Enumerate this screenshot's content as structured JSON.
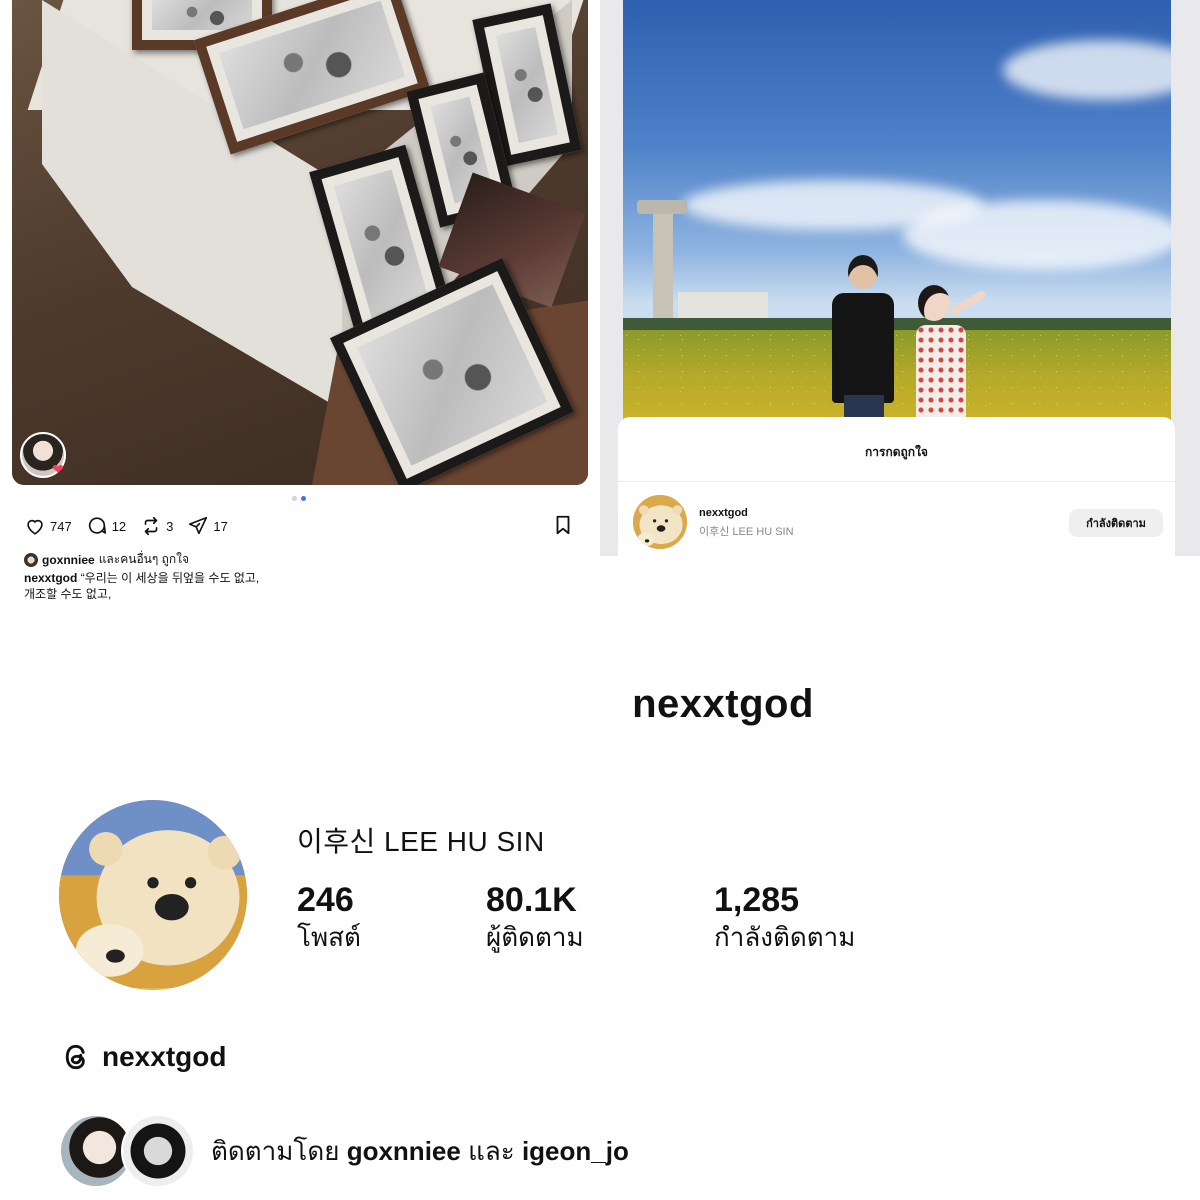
{
  "post": {
    "likes": "747",
    "comments": "12",
    "reposts": "3",
    "shares": "17",
    "liked_by_user": "goxnniee",
    "liked_by_suffix": " และคนอื่นๆ ถูกใจ",
    "caption_user": "nexxtgod",
    "caption_text": " “우리는 이 세상을 뒤엎을 수도 없고,",
    "caption_text_2": "개조할 수도 없고,"
  },
  "likes_sheet": {
    "title": "การกดถูกใจ",
    "liker_username": "nexxtgod",
    "liker_fullname": "이후신 LEE HU SIN",
    "follow_button": "กำลังติดตาม"
  },
  "profile": {
    "username": "nexxtgod",
    "fullname": "이후신 LEE HU SIN",
    "stats": [
      {
        "value": "246",
        "label": "โพสต์"
      },
      {
        "value": "80.1K",
        "label": "ผู้ติดตาม"
      },
      {
        "value": "1,285",
        "label": "กำลังติดตาม"
      }
    ],
    "threads_handle": "nexxtgod",
    "followed_by_prefix": "ติดตามโดย ",
    "followed_by_user1": "goxnniee",
    "followed_by_and": " และ ",
    "followed_by_user2": "igeon_jo"
  },
  "colors": {
    "accent_dot": "#4a6cf7",
    "heart_badge": "#ff3b5c"
  }
}
